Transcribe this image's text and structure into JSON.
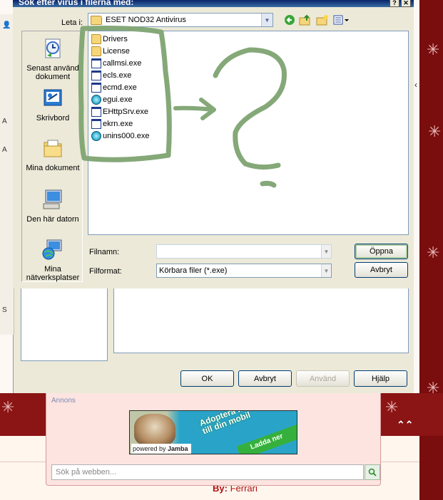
{
  "open_dialog": {
    "title": "Sök efter virus i filerna med:",
    "lookin_label": "Leta i:",
    "lookin_value": "ESET NOD32 Antivirus",
    "places": [
      {
        "label": "Senast använd dokument",
        "icon": "recent-documents-icon"
      },
      {
        "label": "Skrivbord",
        "icon": "desktop-icon"
      },
      {
        "label": "Mina dokument",
        "icon": "my-documents-icon"
      },
      {
        "label": "Den här datorn",
        "icon": "my-computer-icon"
      },
      {
        "label": "Mina nätverksplatser",
        "icon": "network-places-icon"
      }
    ],
    "files": [
      {
        "name": "Drivers",
        "icon": "folder-icon"
      },
      {
        "name": "License",
        "icon": "folder-icon"
      },
      {
        "name": "callmsi.exe",
        "icon": "exe-icon"
      },
      {
        "name": "ecls.exe",
        "icon": "exe-icon"
      },
      {
        "name": "ecmd.exe",
        "icon": "exe-icon"
      },
      {
        "name": "egui.exe",
        "icon": "eset-icon"
      },
      {
        "name": "EHttpSrv.exe",
        "icon": "exe-icon"
      },
      {
        "name": "ekrn.exe",
        "icon": "exe-icon"
      },
      {
        "name": "unins000.exe",
        "icon": "eset-icon"
      }
    ],
    "filename_label": "Filnamn:",
    "filename_value": "",
    "filetype_label": "Filformat:",
    "filetype_value": "Körbara filer (*.exe)",
    "open_button": "Öppna",
    "cancel_button": "Avbryt"
  },
  "properties_dialog": {
    "ok_button": "OK",
    "cancel_button": "Avbryt",
    "apply_button": "Använd",
    "help_button": "Hjälp"
  },
  "annons": {
    "label": "Annons",
    "banner_text_1": "Adoptera mig",
    "banner_text_2": "till din mobil",
    "banner_cta": "Ladda ner",
    "banner_powered": "powered by",
    "banner_brand": "Jamba",
    "search_placeholder": "Sök på webben..."
  },
  "page": {
    "byline_prefix": "By:",
    "byline_name": "Ferrari"
  },
  "colors": {
    "scribble": "#85a878",
    "xp_title": "#0a246a",
    "dialog_face": "#ece9d8",
    "page_red": "#8b1414"
  }
}
